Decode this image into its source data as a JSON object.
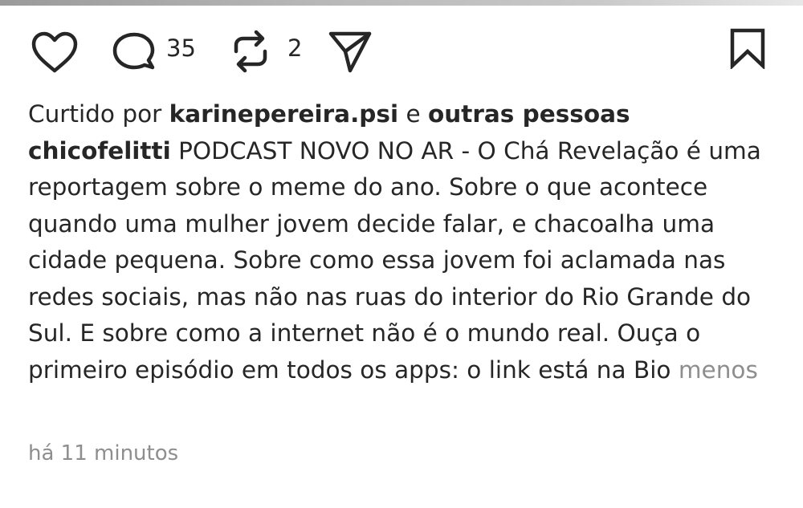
{
  "post": {
    "actions": {
      "like_icon": "heart-icon",
      "comment_icon": "speech-bubble-icon",
      "comment_count": "35",
      "repost_icon": "repost-icon",
      "repost_count": "2",
      "share_icon": "paper-plane-icon",
      "save_icon": "bookmark-icon"
    },
    "likes": {
      "prefix": "Curtido por ",
      "user": "karinepereira.psi",
      "conjunction": " e ",
      "others": "outras pessoas"
    },
    "caption": {
      "author": "chicofelitti",
      "text": " PODCAST NOVO NO AR - O Chá Revelação é uma reportagem sobre o meme do ano. Sobre o que acontece quando uma mulher jovem decide falar, e chacoalha uma cidade pequena. Sobre como essa jovem foi aclamada nas redes sociais, mas não nas ruas do interior do Rio Grande do Sul. E sobre como a internet não é o mundo real. Ouça o primeiro episódio em todos os apps: o link está na Bio ",
      "less_label": "menos"
    },
    "timestamp": "há 11 minutos"
  }
}
